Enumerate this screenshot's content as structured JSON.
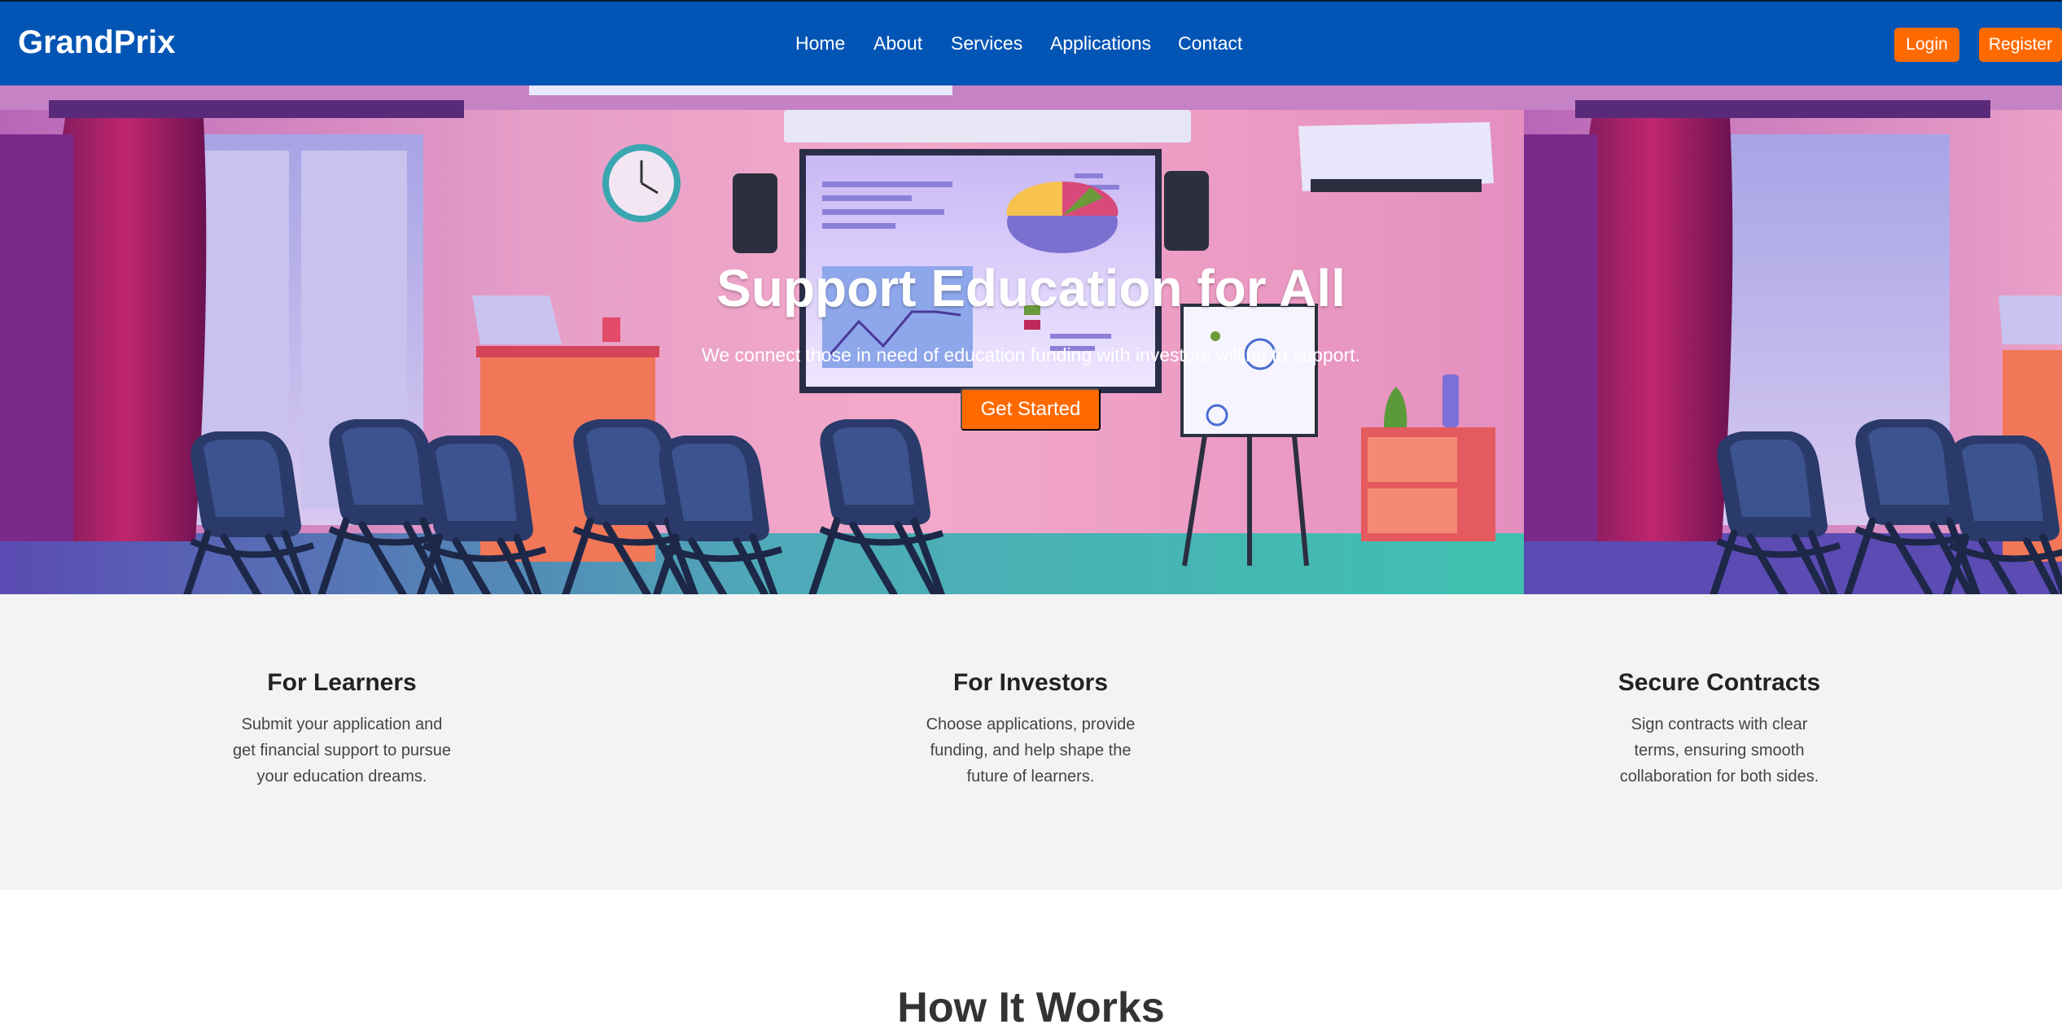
{
  "nav": {
    "brand": "GrandPrix",
    "links": [
      "Home",
      "About",
      "Services",
      "Applications",
      "Contact"
    ],
    "login": "Login",
    "register": "Register"
  },
  "hero": {
    "title": "Support Education for All",
    "subtitle": "We connect those in need of education funding with investors willing to support.",
    "cta": "Get Started"
  },
  "features": [
    {
      "title": "For Learners",
      "text": "Submit your application and get financial support to pursue your education dreams."
    },
    {
      "title": "For Investors",
      "text": "Choose applications, provide funding, and help shape the future of learners."
    },
    {
      "title": "Secure Contracts",
      "text": "Sign contracts with clear terms, ensuring smooth collaboration for both sides."
    }
  ],
  "how": {
    "title": "How It Works"
  },
  "colors": {
    "nav": "#0255b4",
    "accent": "#ff6a00",
    "features_bg": "#f3f3f3"
  }
}
